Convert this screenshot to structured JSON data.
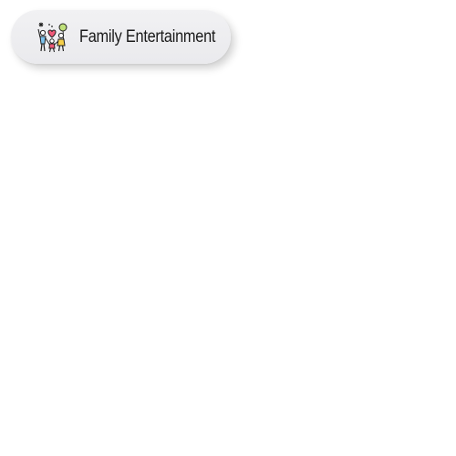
{
  "chip": {
    "label": "Family Entertainment",
    "icon": "family-entertainment-icon"
  },
  "colors": {
    "chip_background": "#eeeef1",
    "text": "#1a1a1a",
    "heart": "#ef5a78",
    "figure_left": "#7cc2ec",
    "figure_right": "#f5cf4a",
    "balloon": "#bfe07a"
  }
}
